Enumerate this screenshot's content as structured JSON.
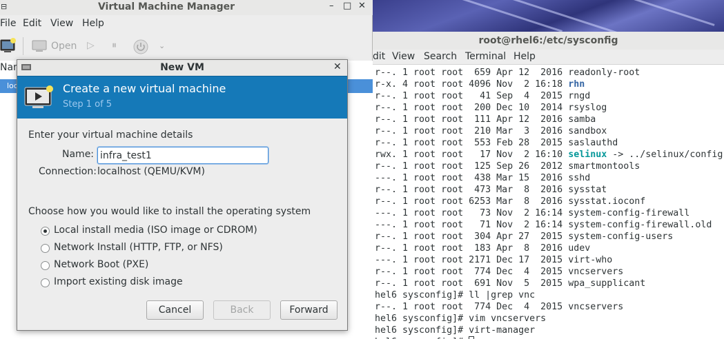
{
  "vmm": {
    "title": "Virtual Machine Manager",
    "menu": [
      "File",
      "Edit",
      "View",
      "Help"
    ],
    "toolbar": {
      "open_label": "Open"
    },
    "list_header": "Nam",
    "list_row": "loc"
  },
  "dialog": {
    "title": "New VM",
    "banner_title": "Create a new virtual machine",
    "step": "Step 1 of 5",
    "details_heading": "Enter your virtual machine details",
    "name_label": "Name:",
    "name_value": "infra_test1",
    "connection_label": "Connection:",
    "connection_value": "localhost (QEMU/KVM)",
    "install_heading": "Choose how you would like to install the operating system",
    "options": [
      {
        "label": "Local install media (ISO image or CDROM)",
        "selected": true
      },
      {
        "label": "Network Install (HTTP, FTP, or NFS)",
        "selected": false
      },
      {
        "label": "Network Boot (PXE)",
        "selected": false
      },
      {
        "label": "Import existing disk image",
        "selected": false
      }
    ],
    "buttons": {
      "cancel": "Cancel",
      "back": "Back",
      "forward": "Forward"
    }
  },
  "terminal": {
    "title": "root@rhel6:/etc/sysconfig",
    "menu": [
      "dit",
      "View",
      "Search",
      "Terminal",
      "Help"
    ],
    "lines": [
      [
        {
          "t": "r--. 1 root root  659 Apr 12  2016 readonly-root"
        }
      ],
      [
        {
          "t": "r-x. 4 root root 4096 Nov  2 16:18 "
        },
        {
          "t": "rhn",
          "c": "dir"
        }
      ],
      [
        {
          "t": "r--. 1 root root   41 Sep  4  2015 rngd"
        }
      ],
      [
        {
          "t": "r--. 1 root root  200 Dec 10  2014 rsyslog"
        }
      ],
      [
        {
          "t": "r--. 1 root root  111 Apr 12  2016 samba"
        }
      ],
      [
        {
          "t": "r--. 1 root root  210 Mar  3  2016 sandbox"
        }
      ],
      [
        {
          "t": "r--. 1 root root  553 Feb 28  2015 saslauthd"
        }
      ],
      [
        {
          "t": "rwx. 1 root root   17 Nov  2 16:10 "
        },
        {
          "t": "selinux",
          "c": "lnk"
        },
        {
          "t": " -> ../selinux/config"
        }
      ],
      [
        {
          "t": "r--. 1 root root  125 Sep 26  2012 smartmontools"
        }
      ],
      [
        {
          "t": "---. 1 root root  438 Mar 15  2016 sshd"
        }
      ],
      [
        {
          "t": "r--. 1 root root  473 Mar  8  2016 sysstat"
        }
      ],
      [
        {
          "t": "r--. 1 root root 6253 Mar  8  2016 sysstat.ioconf"
        }
      ],
      [
        {
          "t": "---. 1 root root   73 Nov  2 16:14 system-config-firewall"
        }
      ],
      [
        {
          "t": "---. 1 root root   71 Nov  2 16:14 system-config-firewall.old"
        }
      ],
      [
        {
          "t": "r--. 1 root root  304 Apr 27  2015 system-config-users"
        }
      ],
      [
        {
          "t": "r--. 1 root root  183 Apr  8  2016 udev"
        }
      ],
      [
        {
          "t": "---. 1 root root 2171 Dec 17  2015 virt-who"
        }
      ],
      [
        {
          "t": "r--. 1 root root  774 Dec  4  2015 vncservers"
        }
      ],
      [
        {
          "t": "r--. 1 root root  691 Nov  5  2015 wpa_supplicant"
        }
      ],
      [
        {
          "t": "hel6 sysconfig]# ll |grep vnc"
        }
      ],
      [
        {
          "t": "r--. 1 root root  774 Dec  4  2015 vncservers"
        }
      ],
      [
        {
          "t": "hel6 sysconfig]# vim vncservers"
        }
      ],
      [
        {
          "t": "hel6 sysconfig]# virt-manager"
        }
      ],
      [
        {
          "t": "hel6 sysconfig]# "
        },
        {
          "cursor": true
        }
      ]
    ]
  },
  "colors": {
    "banner": "#1579b8",
    "selection": "#4a90d9",
    "directory": "#3465a4",
    "symlink": "#06989a"
  }
}
